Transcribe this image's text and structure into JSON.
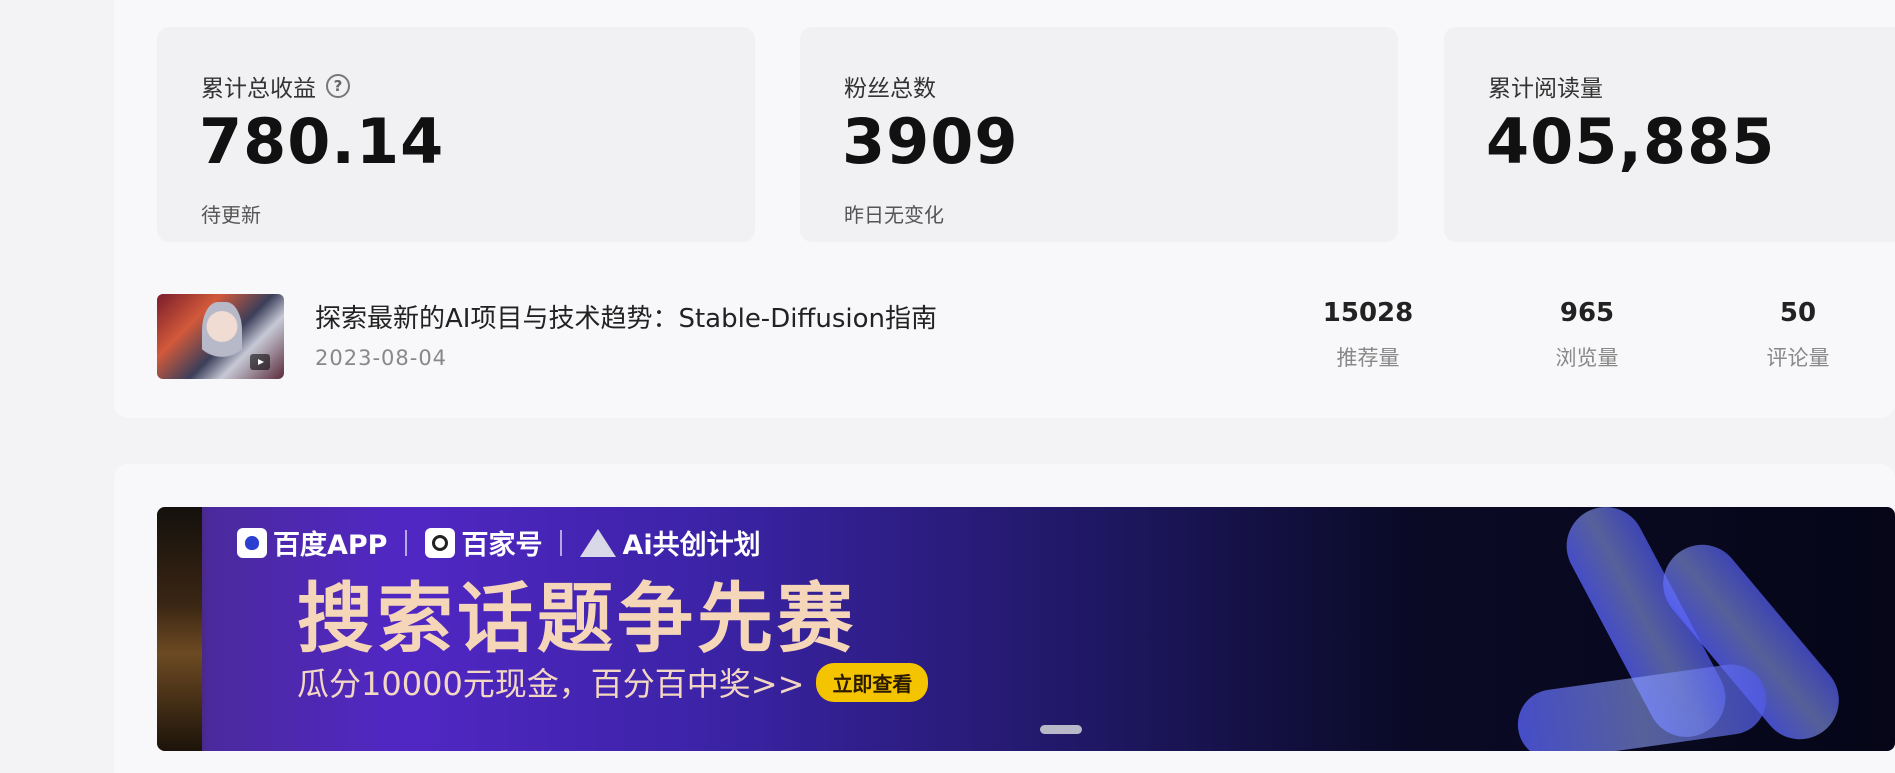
{
  "stats": [
    {
      "label": "累计总收益",
      "value": "780.14",
      "sub": "待更新",
      "has_help": true
    },
    {
      "label": "粉丝总数",
      "value": "3909",
      "sub": "昨日无变化",
      "has_help": false
    },
    {
      "label": "累计阅读量",
      "value": "405,885",
      "sub": "",
      "has_help": false
    }
  ],
  "article": {
    "title": "探索最新的AI项目与技术趋势：Stable-Diffusion指南",
    "date": "2023-08-04",
    "metrics": [
      {
        "value": "15028",
        "label": "推荐量"
      },
      {
        "value": "965",
        "label": "浏览量"
      },
      {
        "value": "50",
        "label": "评论量"
      }
    ]
  },
  "banner": {
    "brands": [
      "百度APP",
      "百家号",
      "Ai共创计划"
    ],
    "headline": "搜索话题争先赛",
    "subline": "瓜分10000元现金，百分百中奖>>",
    "cta": "立即查看"
  }
}
